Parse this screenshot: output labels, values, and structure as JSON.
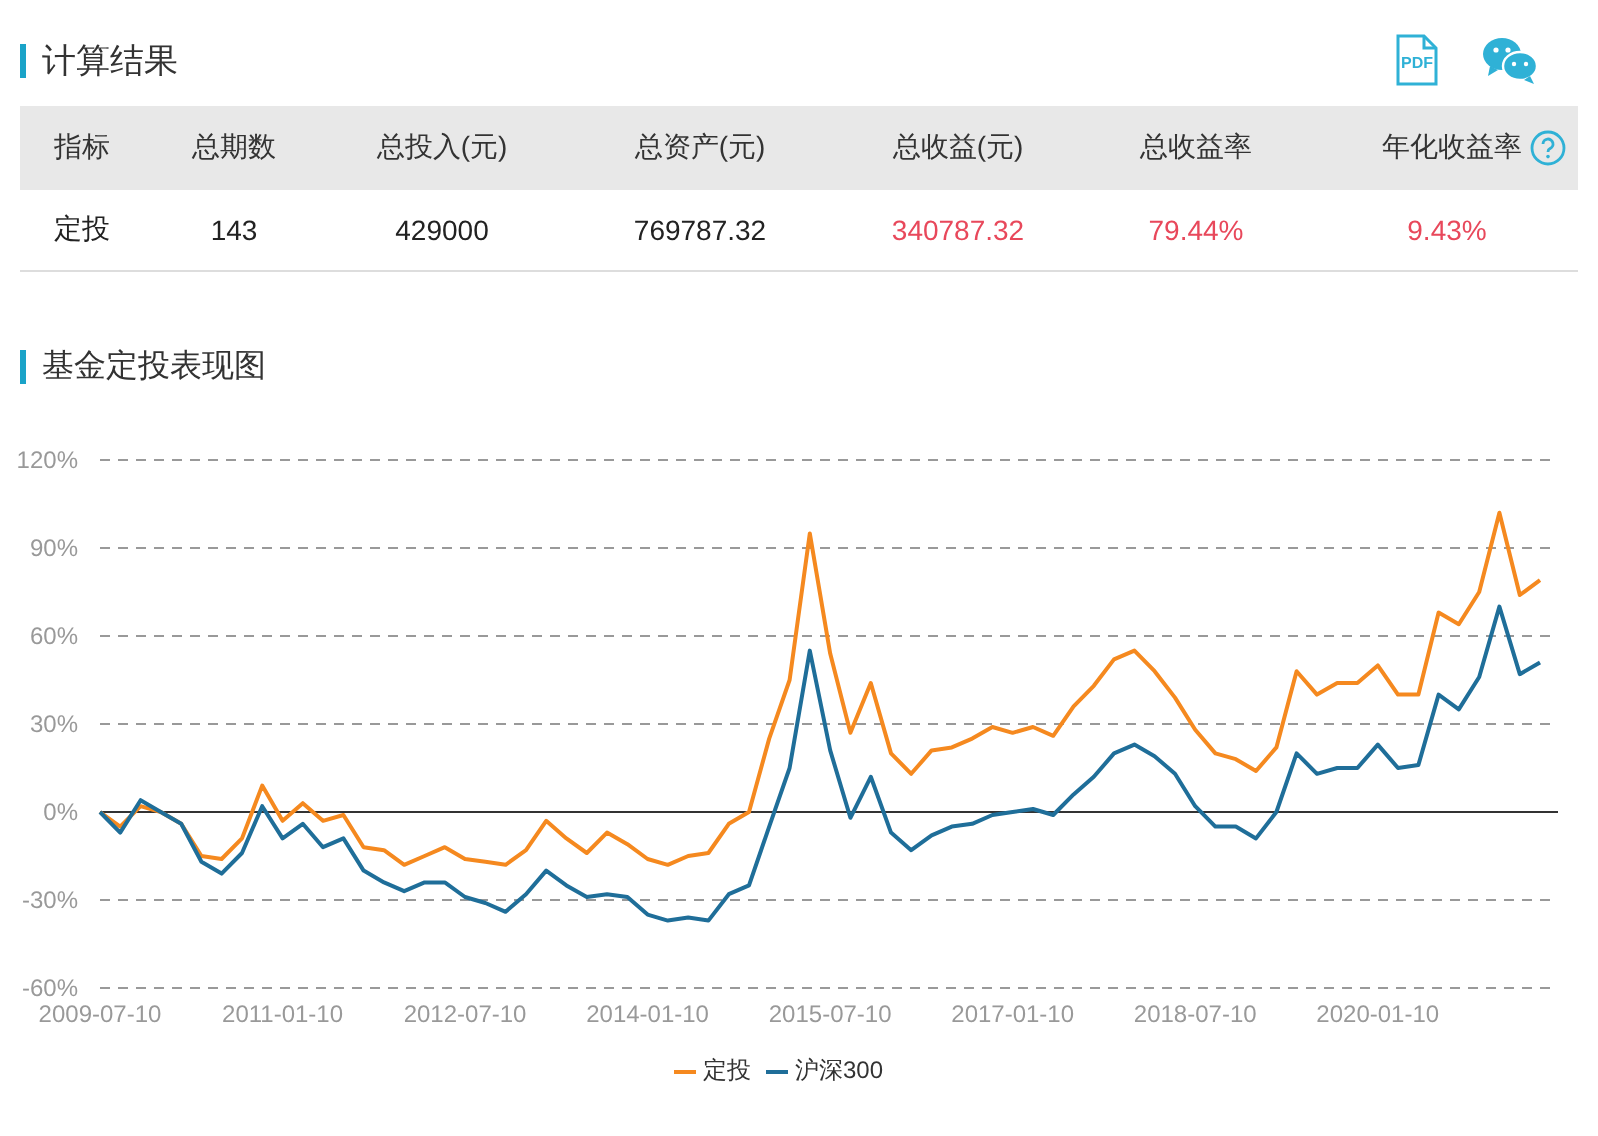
{
  "header": {
    "title": "计算结果",
    "pdf_icon_label": "PDF"
  },
  "table": {
    "columns": [
      "指标",
      "总期数",
      "总投入(元)",
      "总资产(元)",
      "总收益(元)",
      "总收益率",
      "年化收益率"
    ],
    "rows": [
      [
        "定投",
        "143",
        "429000",
        "769787.32",
        "340787.32",
        "79.44%",
        "9.43%"
      ]
    ]
  },
  "chart_section": {
    "title": "基金定投表现图",
    "chart_data": {
      "type": "line",
      "categories": [
        "2009-07-10",
        null,
        null,
        null,
        null,
        null,
        null,
        null,
        null,
        "2011-01-10",
        null,
        null,
        null,
        null,
        null,
        null,
        null,
        null,
        "2012-07-10",
        null,
        null,
        null,
        null,
        null,
        null,
        null,
        null,
        "2014-01-10",
        null,
        null,
        null,
        null,
        null,
        null,
        null,
        null,
        "2015-07-10",
        null,
        null,
        null,
        null,
        null,
        null,
        null,
        null,
        "2017-01-10",
        null,
        null,
        null,
        null,
        null,
        null,
        null,
        null,
        "2018-07-10",
        null,
        null,
        null,
        null,
        null,
        null,
        null,
        null,
        "2020-01-10",
        null,
        null,
        null,
        null,
        null,
        null,
        null,
        null
      ],
      "series": [
        {
          "name": "定投",
          "color": "#f5891f",
          "values": [
            0,
            -5,
            2,
            0,
            -4,
            -15,
            -16,
            -9,
            9,
            -3,
            3,
            -3,
            -1,
            -12,
            -13,
            -18,
            -15,
            -12,
            -16,
            -17,
            -18,
            -13,
            -3,
            -9,
            -14,
            -7,
            -11,
            -16,
            -18,
            -15,
            -14,
            -4,
            0,
            25,
            45,
            95,
            54,
            27,
            44,
            20,
            13,
            21,
            22,
            25,
            29,
            27,
            29,
            26,
            36,
            43,
            52,
            55,
            48,
            39,
            28,
            20,
            18,
            14,
            22,
            48,
            40,
            44,
            44,
            50,
            40,
            40,
            68,
            64,
            75,
            102,
            74,
            79
          ]
        },
        {
          "name": "沪深300",
          "color": "#1f6e99",
          "values": [
            0,
            -7,
            4,
            0,
            -4,
            -17,
            -21,
            -14,
            2,
            -9,
            -4,
            -12,
            -9,
            -20,
            -24,
            -27,
            -24,
            -24,
            -29,
            -31,
            -34,
            -28,
            -20,
            -25,
            -29,
            -28,
            -29,
            -35,
            -37,
            -36,
            -37,
            -28,
            -25,
            -5,
            15,
            55,
            21,
            -2,
            12,
            -7,
            -13,
            -8,
            -5,
            -4,
            -1,
            0,
            1,
            -1,
            6,
            12,
            20,
            23,
            19,
            13,
            2,
            -5,
            -5,
            -9,
            0,
            20,
            13,
            15,
            15,
            23,
            15,
            16,
            40,
            35,
            46,
            70,
            47,
            51
          ]
        }
      ],
      "ylim": [
        -60,
        120
      ],
      "grid": true,
      "yticks": [
        {
          "value": -60,
          "label": "-60%"
        },
        {
          "value": -30,
          "label": "-30%"
        },
        {
          "value": 0,
          "label": "0%"
        },
        {
          "value": 30,
          "label": "30%"
        },
        {
          "value": 60,
          "label": "60%"
        },
        {
          "value": 90,
          "label": "90%"
        },
        {
          "value": 120,
          "label": "120%"
        }
      ]
    }
  }
}
